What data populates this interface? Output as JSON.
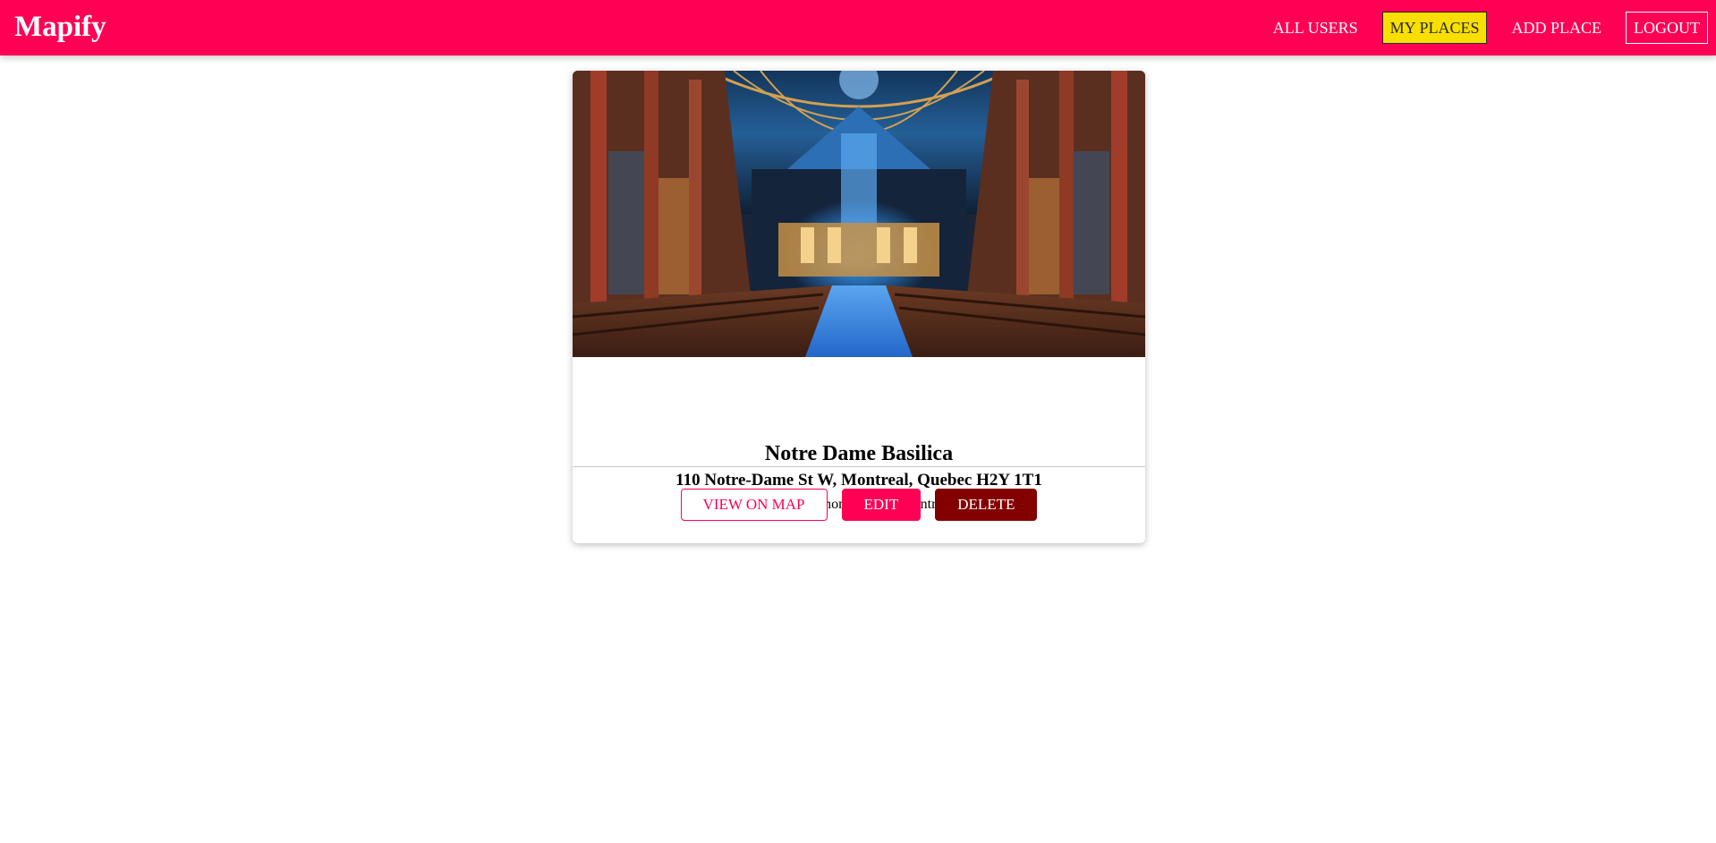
{
  "app": {
    "name": "Mapify",
    "accent_color": "#ff0055",
    "active_nav_color": "#f8df00",
    "danger_color": "#830000"
  },
  "nav": {
    "items": [
      {
        "label": "ALL USERS",
        "active": false
      },
      {
        "label": "MY PLACES",
        "active": true
      },
      {
        "label": "ADD PLACE",
        "active": false
      },
      {
        "label": "LOGOUT",
        "active": false
      }
    ]
  },
  "place": {
    "title": "Notre Dame Basilica",
    "address": "110 Notre-Dame St W, Montreal, Quebec H2Y 1T1",
    "description": "A famous monument of Montreal.",
    "image_icon": "basilica-interior-photo"
  },
  "actions": {
    "view_on_map": "VIEW ON MAP",
    "edit": "EDIT",
    "delete": "DELETE"
  }
}
